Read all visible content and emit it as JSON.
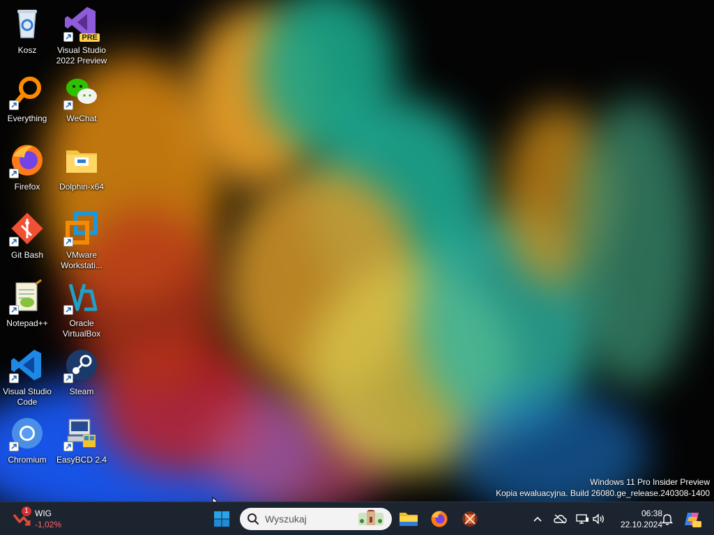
{
  "desktop": {
    "icons": [
      {
        "label": "Kosz",
        "icon": "recycle-bin-icon"
      },
      {
        "label": "Visual Studio 2022 Preview",
        "icon": "visual-studio-icon",
        "badge": "PRE"
      },
      {
        "label": "Everything",
        "icon": "everything-search-icon"
      },
      {
        "label": "WeChat",
        "icon": "wechat-icon"
      },
      {
        "label": "Firefox",
        "icon": "firefox-icon"
      },
      {
        "label": "Dolphin-x64",
        "icon": "folder-icon"
      },
      {
        "label": "Git Bash",
        "icon": "git-icon"
      },
      {
        "label": "VMware Workstati...",
        "icon": "vmware-icon"
      },
      {
        "label": "Notepad++",
        "icon": "notepad-plus-plus-icon"
      },
      {
        "label": "Oracle VirtualBox",
        "icon": "virtualbox-icon"
      },
      {
        "label": "Visual Studio Code",
        "icon": "vscode-icon"
      },
      {
        "label": "Steam",
        "icon": "steam-icon"
      },
      {
        "label": "Chromium",
        "icon": "chromium-icon"
      },
      {
        "label": "EasyBCD 2.4",
        "icon": "easybcd-icon"
      }
    ]
  },
  "watermark": {
    "line1": "Windows 11 Pro Insider Preview",
    "line2": "Kopia ewaluacyjna. Build 26080.ge_release.240308-1400"
  },
  "taskbar": {
    "widget": {
      "title": "WIG",
      "value": "-1,02%",
      "badge": "1"
    },
    "search": {
      "placeholder": "Wyszukaj"
    },
    "clock": {
      "time": "06:38",
      "date": "22.10.2024"
    }
  },
  "colors": {
    "taskbar_bg": "#1c2430",
    "accent_blue": "#0078d4",
    "widget_negative": "#ff6b6b"
  }
}
